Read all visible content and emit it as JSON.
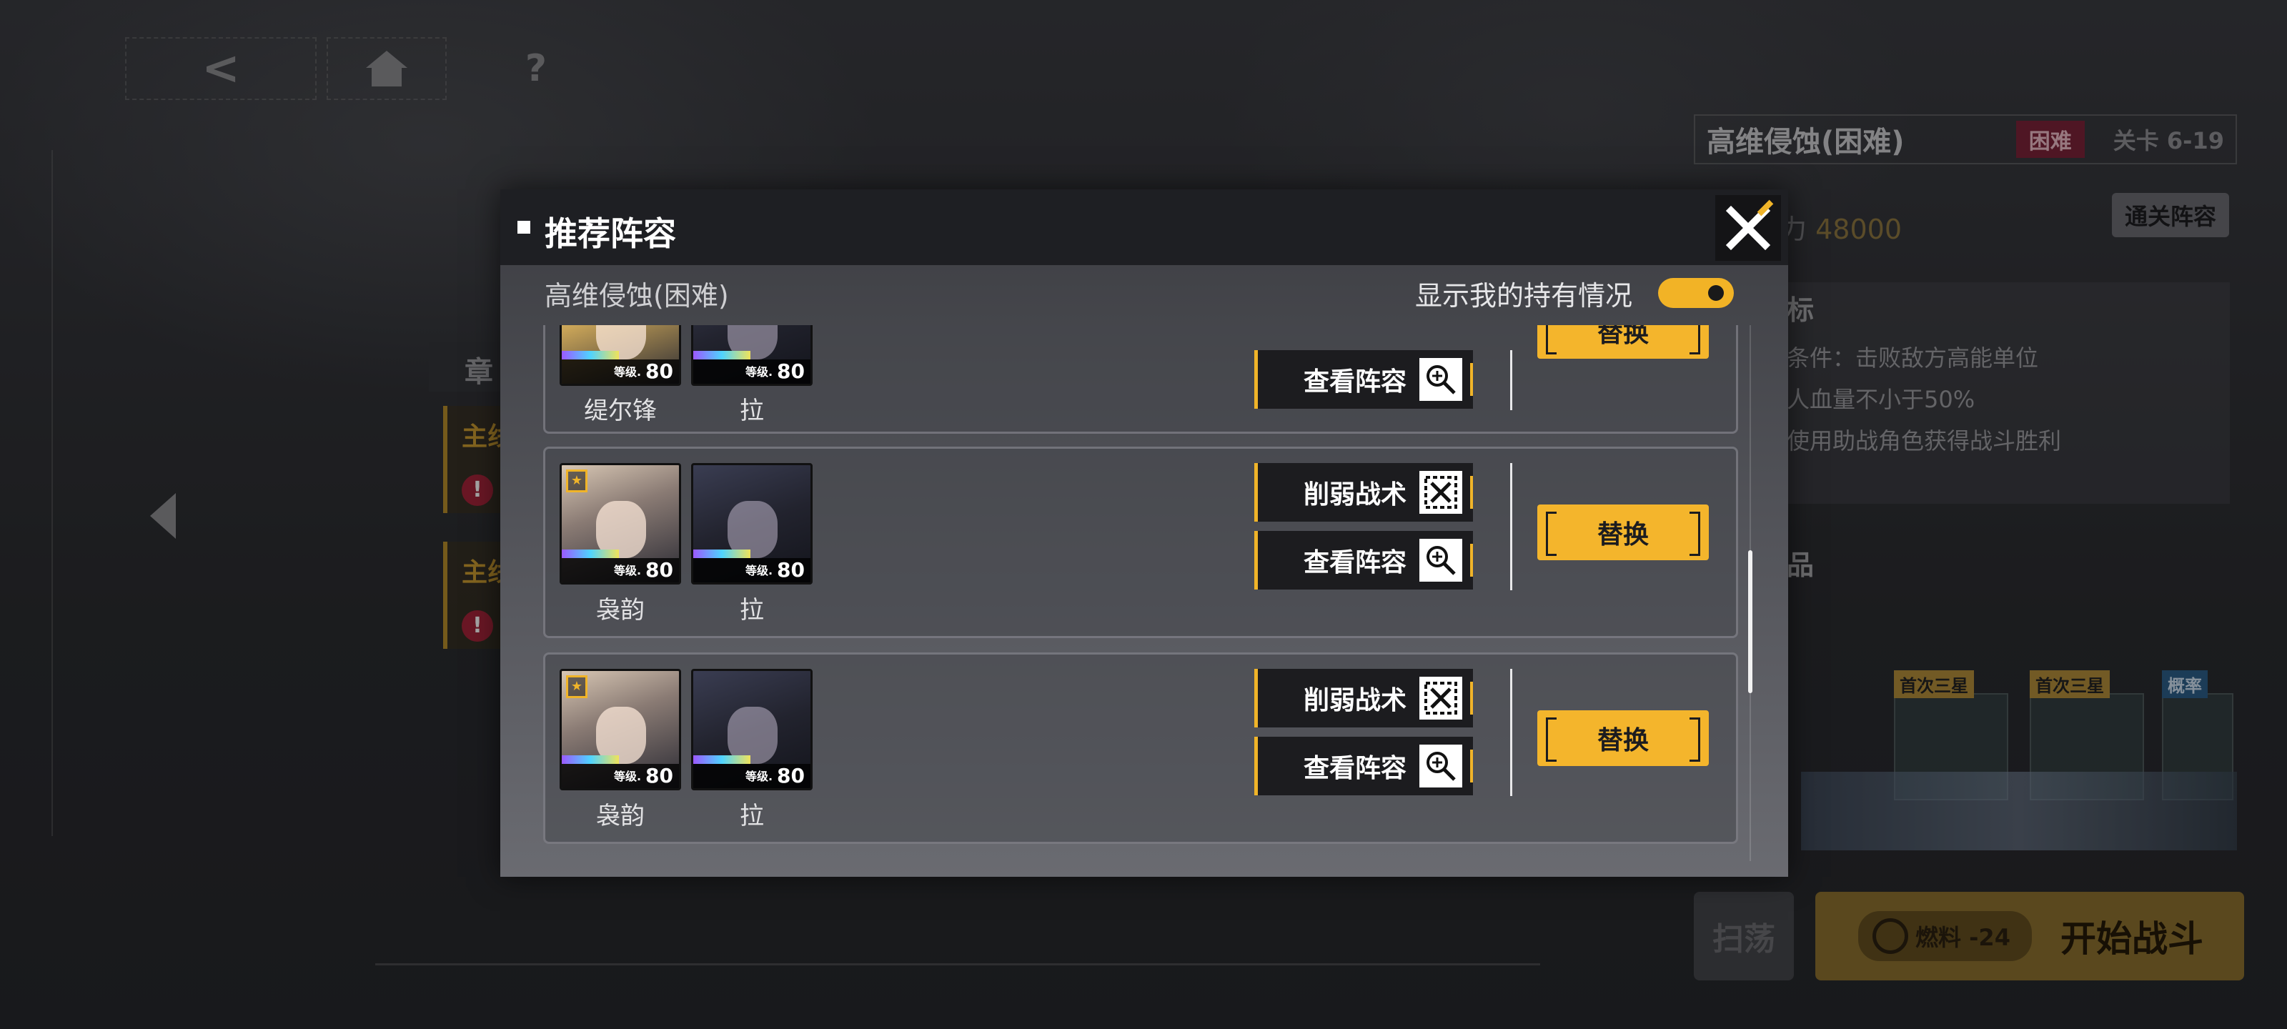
{
  "nav": {
    "back_icon": "<",
    "home_icon": "home-icon",
    "help_icon": "?"
  },
  "chapter": {
    "header": "章",
    "items": [
      {
        "label": "主线"
      },
      {
        "label": "主线"
      }
    ]
  },
  "stage_panel": {
    "title": "高维侵蚀(困难)",
    "difficulty_badge": "困难",
    "stage_code": "关卡 6-19",
    "power_label": "力",
    "power_value": "48000",
    "clear_team_button": "通关阵容",
    "goal_header": "标",
    "goals": [
      "条件：击败敌方高能单位",
      "人血量不小于50%",
      "使用助战角色获得战斗胜利"
    ],
    "drops_header": "品",
    "drop_tags": [
      "首次三星",
      "首次三星",
      "概率"
    ],
    "sweep_button": "扫荡",
    "fuel_label": "燃料 -24",
    "start_button": "开始战斗"
  },
  "modal": {
    "title": "推荐阵容",
    "subtitle": "高维侵蚀(困难)",
    "toggle_label": "显示我的持有情况",
    "toggle_on": true,
    "level_prefix": "等级.",
    "cards": [
      {
        "members": [
          {
            "name": "缇尔锋",
            "level": "80"
          },
          {
            "name": "拉",
            "level": "80"
          }
        ],
        "view_label": "查看阵容",
        "replace_label": "替换"
      },
      {
        "members": [
          {
            "name": "袅韵",
            "level": "80"
          },
          {
            "name": "拉",
            "level": "80"
          }
        ],
        "weaken_label": "削弱战术",
        "view_label": "查看阵容",
        "replace_label": "替换"
      },
      {
        "members": [
          {
            "name": "袅韵",
            "level": "80"
          },
          {
            "name": "拉",
            "level": "80"
          }
        ],
        "weaken_label": "削弱战术",
        "view_label": "查看阵容",
        "replace_label": "替换"
      }
    ]
  },
  "colors": {
    "accent": "#f4b52c",
    "modal_header": "#1e1f23",
    "badge": "#7a2238"
  }
}
